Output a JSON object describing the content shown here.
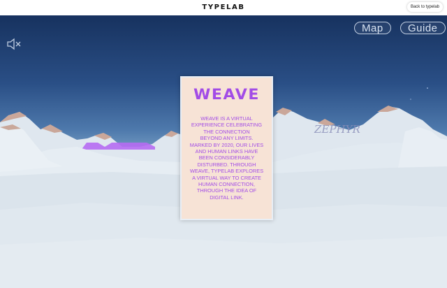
{
  "header": {
    "brand": "TYPELAB",
    "back_button": "Back to typelab"
  },
  "hud": {
    "sound_icon": "speaker-muted-icon",
    "map_button": "Map",
    "guide_button": "Guide"
  },
  "card": {
    "title": "WEAVE",
    "body_lines": [
      "WEAVE IS A VIRTUAL",
      "EXPERIENCE CELEBRATING",
      "THE CONNECTION",
      "BEYOND ANY LIMITS.",
      "MARKED BY 2020, OUR LIVES",
      "AND HUMAN LINKS HAVE",
      "BEEN CONSIDERABLY",
      "DISTURBED. THROUGH",
      "WEAVE, TYPELAB EXPLORES",
      "A VIRTUAL WAY TO CREATE",
      "HUMAN CONNECTION,",
      "THROUGH THE IDEA OF",
      "DIGITAL LINK."
    ]
  },
  "scene": {
    "background_word": "ZEPHYR"
  },
  "colors": {
    "accent_purple": "#a24ce6",
    "card_bg": "#f7e3d6",
    "sky_top": "#17325f",
    "snow": "#e6edf3"
  }
}
